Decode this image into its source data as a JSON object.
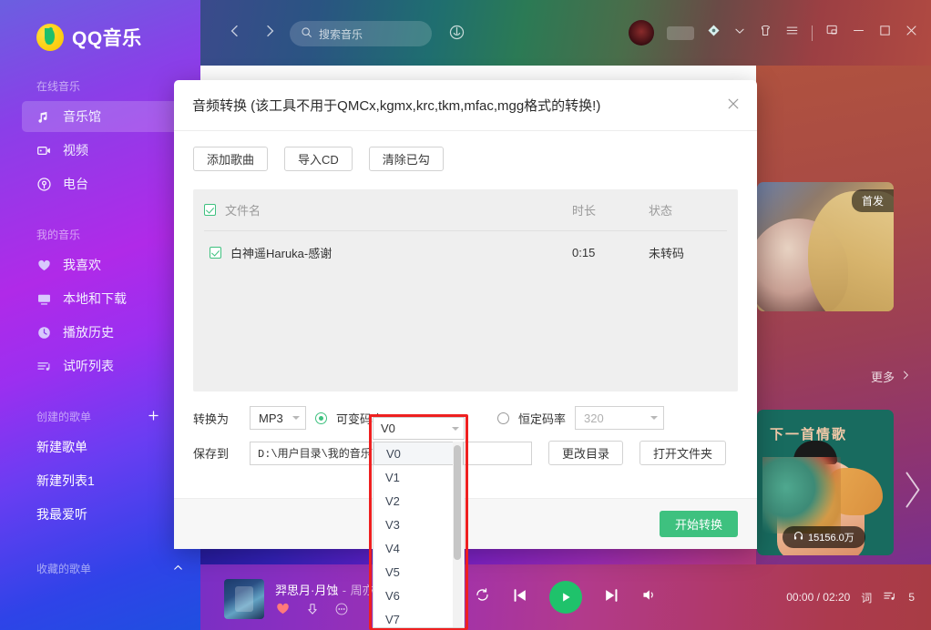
{
  "app": {
    "name": "QQ音乐",
    "logo_icon": "qq-music-logo-icon"
  },
  "sidebar": {
    "groups": [
      {
        "title": "在线音乐",
        "items": [
          {
            "label": "音乐馆",
            "icon": "music-note-icon",
            "active": true
          },
          {
            "label": "视频",
            "icon": "video-camera-icon",
            "active": false
          },
          {
            "label": "电台",
            "icon": "radio-icon",
            "active": false
          }
        ]
      },
      {
        "title": "我的音乐",
        "items": [
          {
            "label": "我喜欢",
            "icon": "heart-icon",
            "active": false
          },
          {
            "label": "本地和下载",
            "icon": "monitor-icon",
            "active": false
          },
          {
            "label": "播放历史",
            "icon": "clock-icon",
            "active": false
          },
          {
            "label": "试听列表",
            "icon": "playlist-icon",
            "active": false
          }
        ]
      },
      {
        "title": "创建的歌单",
        "actions": [
          "plus-icon",
          "chevron-up-icon"
        ],
        "items": [
          {
            "label": "新建歌单",
            "icon": "",
            "active": false
          },
          {
            "label": "新建列表1",
            "icon": "",
            "active": false
          },
          {
            "label": "我最爱听",
            "icon": "",
            "active": false
          }
        ]
      },
      {
        "title": "收藏的歌单",
        "actions": [
          "chevron-up-icon"
        ],
        "items": []
      }
    ]
  },
  "topbar": {
    "back_icon": "chevron-left-icon",
    "forward_icon": "chevron-right-icon",
    "search": {
      "placeholder": "搜索音乐",
      "value": "",
      "icon": "search-icon"
    },
    "mic_icon": "microphone-icon",
    "avatar_icon": "user-avatar",
    "vip_icon": "vip-badge-icon",
    "diamond_icon": "diamond-icon",
    "chevron_icon": "chevron-down-icon",
    "shirt_icon": "skin-shirt-icon",
    "menu_icon": "hamburger-menu-icon",
    "mini_icon": "mini-window-icon",
    "minimize_icon": "minimize-icon",
    "maximize_icon": "maximize-icon",
    "close_icon": "close-icon"
  },
  "rail": {
    "card1": {
      "badge": "首发"
    },
    "more_label": "更多",
    "more_icon": "chevron-right-icon",
    "card2": {
      "title": "下一首情歌",
      "play_count": "15156.0万",
      "headphone_icon": "headphone-icon"
    },
    "next_icon": "chevron-right-large-icon"
  },
  "player": {
    "song_title": "羿思月·月蚀",
    "separator": "-",
    "artist": "周亦铭",
    "like_icon": "heart-filled-icon",
    "download_icon": "download-arrow-icon",
    "more_icon": "ellipsis-icon",
    "repeat_icon": "repeat-icon",
    "prev_icon": "previous-track-icon",
    "play_icon": "play-icon",
    "next_icon": "next-track-icon",
    "volume_icon": "volume-icon",
    "time": "00:00 / 02:20",
    "lyric_label": "词",
    "queue_icon": "queue-list-icon",
    "queue_count": "5"
  },
  "dialog": {
    "title": "音频转换 (该工具不用于QMCx,kgmx,krc,tkm,mfac,mgg格式的转换!)",
    "close_icon": "close-icon",
    "toolbar": [
      {
        "label": "添加歌曲"
      },
      {
        "label": "导入CD"
      },
      {
        "label": "清除已勾"
      }
    ],
    "table": {
      "headers": {
        "name": "文件名",
        "duration": "时长",
        "status": "状态"
      },
      "header_checked": true,
      "rows": [
        {
          "checked": true,
          "name": "白神遥Haruka-感谢",
          "duration": "0:15",
          "status": "未转码"
        }
      ]
    },
    "settings": {
      "convert_label": "转换为",
      "format_value": "MP3",
      "vbr": {
        "label": "可变码率",
        "selected": true,
        "value": "V0"
      },
      "cbr": {
        "label": "恒定码率",
        "selected": false,
        "value": "320"
      },
      "save_label": "保存到",
      "save_path": "D:\\用户目录\\我的音乐\\",
      "change_dir_label": "更改目录",
      "open_folder_label": "打开文件夹"
    },
    "footer": {
      "start_label": "开始转换"
    }
  },
  "dropdown": {
    "highlighted": true,
    "highlight_color": "#ee2020",
    "selected": "V0",
    "options": [
      "V0",
      "V1",
      "V2",
      "V3",
      "V4",
      "V5",
      "V6",
      "V7"
    ],
    "caret_icon": "caret-down-icon"
  },
  "colors": {
    "accent_green": "#3ec17f",
    "highlight_red": "#ee2020",
    "sidebar_gradient_start": "#6b5fe0",
    "sidebar_gradient_end": "#1f4fe0"
  }
}
